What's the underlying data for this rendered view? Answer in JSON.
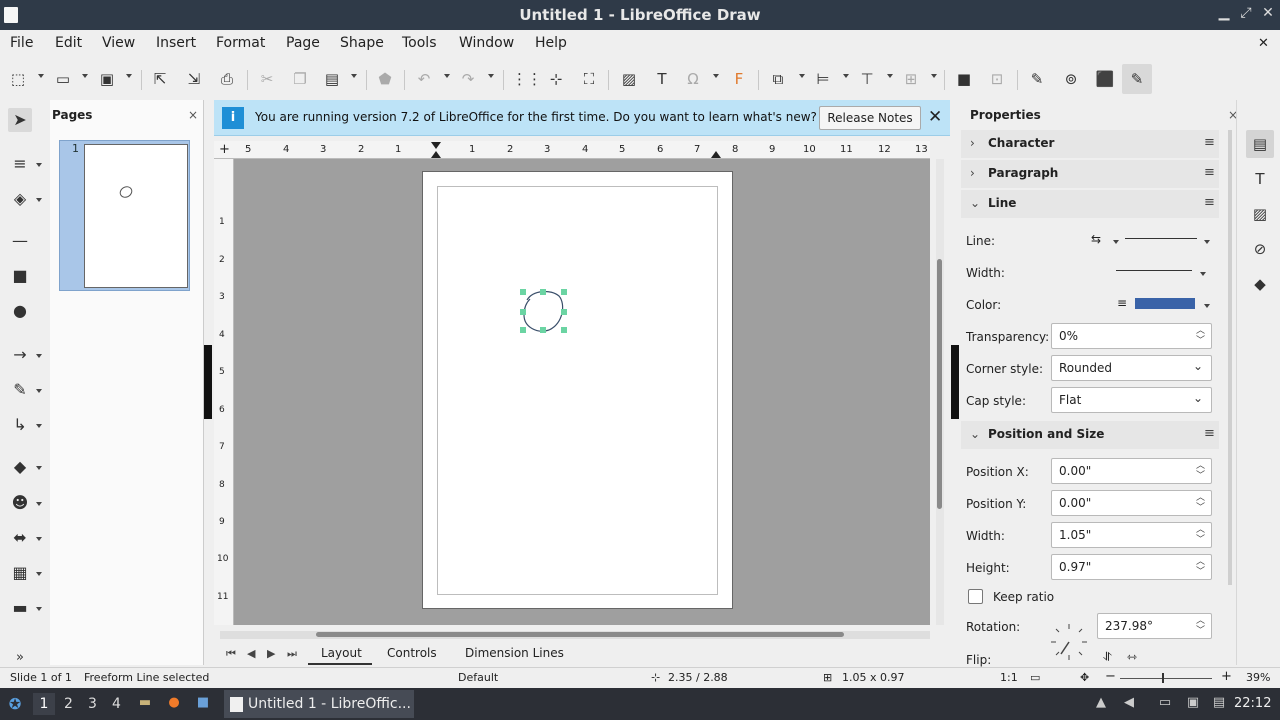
{
  "window": {
    "title": "Untitled 1 - LibreOffice Draw",
    "minimize": "▁",
    "restore": "⤢",
    "close": "✕"
  },
  "menu": {
    "items": [
      "File",
      "Edit",
      "View",
      "Insert",
      "Format",
      "Page",
      "Shape",
      "Tools",
      "Window",
      "Help"
    ],
    "close_doc": "✕"
  },
  "infobar": {
    "icon": "i",
    "message": "You are running version 7.2 of LibreOffice for the first time. Do you want to learn what's new?",
    "button": "Release Notes",
    "close": "✕"
  },
  "pages_panel": {
    "title": "Pages",
    "close": "×",
    "page_number": "1"
  },
  "hruler": {
    "ticks": [
      "5",
      "4",
      "3",
      "2",
      "1",
      "1",
      "2",
      "3",
      "4",
      "5",
      "6",
      "7",
      "8",
      "9",
      "10",
      "11",
      "12",
      "13"
    ]
  },
  "vruler": {
    "ticks": [
      "1",
      "2",
      "3",
      "4",
      "5",
      "6",
      "7",
      "8",
      "9",
      "10",
      "11"
    ]
  },
  "tabs": {
    "items": [
      "Layout",
      "Controls",
      "Dimension Lines"
    ]
  },
  "sidebar": {
    "title": "Properties",
    "close": "×",
    "sections": {
      "character": "Character",
      "paragraph": "Paragraph",
      "line": "Line",
      "possize": "Position and Size"
    },
    "line": {
      "line_label": "Line:",
      "width_label": "Width:",
      "color_label": "Color:",
      "transparency_label": "Transparency:",
      "transparency_value": "0%",
      "corner_label": "Corner style:",
      "corner_value": "Rounded",
      "cap_label": "Cap style:",
      "cap_value": "Flat",
      "color": "#3a63a8"
    },
    "possize": {
      "posx_label": "Position X:",
      "posx_value": "0.00\"",
      "posy_label": "Position Y:",
      "posy_value": "0.00\"",
      "width_label": "Width:",
      "width_value": "1.05\"",
      "height_label": "Height:",
      "height_value": "0.97\"",
      "keep_ratio": "Keep ratio",
      "rotation_label": "Rotation:",
      "rotation_value": "237.98°",
      "flip_label": "Flip:"
    }
  },
  "statusbar": {
    "slide": "Slide 1 of 1",
    "selection": "Freeform Line selected",
    "layout": "Default",
    "position": "2.35 / 2.88",
    "size": "1.05 x 0.97",
    "scale": "1:1",
    "zoom": "39%",
    "zoom_minus": "−",
    "zoom_plus": "+"
  },
  "taskbar": {
    "workspaces": [
      "1",
      "2",
      "3",
      "4"
    ],
    "app": "Untitled 1 - LibreOffic...",
    "clock": "22:12"
  },
  "colors": {
    "titlebar": "#2f3a48",
    "selection_handle": "#6bd4a3",
    "infobar": "#bde3f7",
    "accent": "#1f8fd6"
  }
}
